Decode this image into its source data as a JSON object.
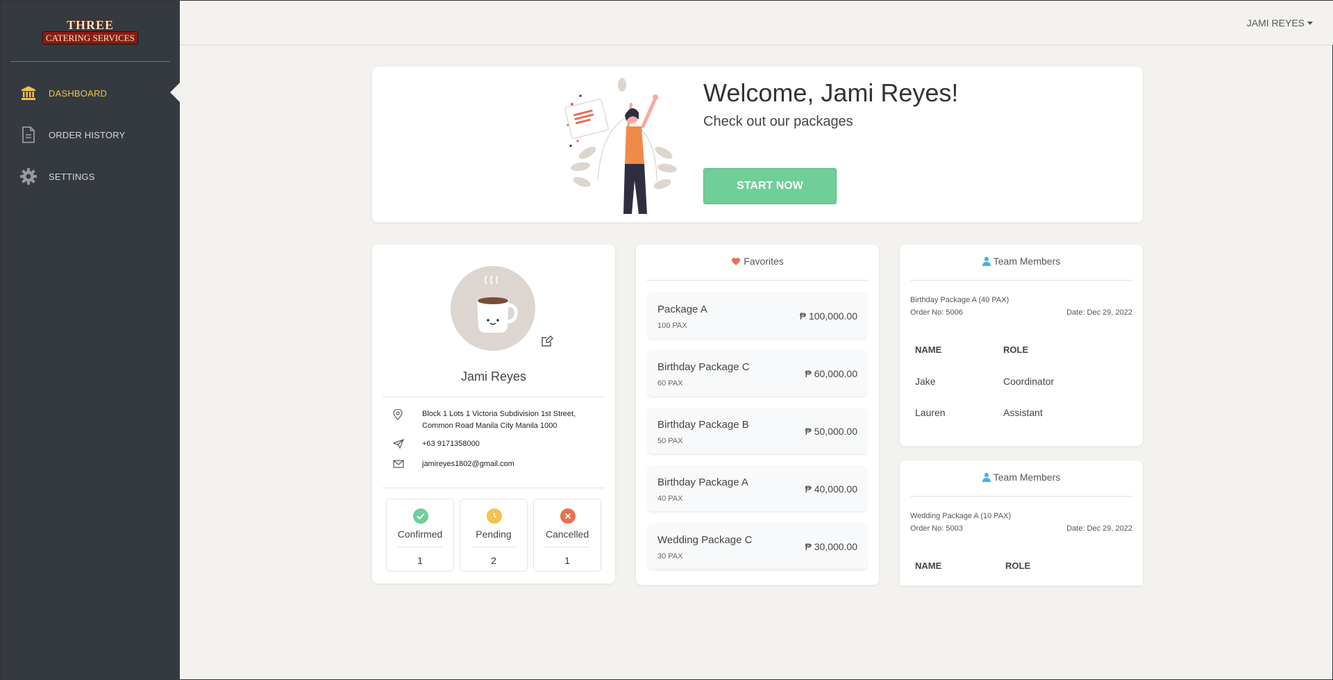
{
  "logo": {
    "line1": "THREE",
    "line2": "CATERING SERVICES"
  },
  "sidebar": {
    "items": [
      {
        "label": "DASHBOARD",
        "icon": "bank-icon"
      },
      {
        "label": "ORDER HISTORY",
        "icon": "document-icon"
      },
      {
        "label": "SETTINGS",
        "icon": "gear-icon"
      }
    ]
  },
  "topbar": {
    "user": "JAMI REYES"
  },
  "welcome": {
    "title": "Welcome, Jami Reyes!",
    "subtitle": "Check out our packages",
    "button": "START NOW"
  },
  "profile": {
    "name": "Jami Reyes",
    "address_line1": "Block 1 Lots 1 Victoria Subdivision 1st Street,",
    "address_line2": "Common Road Manila City Manila 1000",
    "phone": "+63 9171358000",
    "email": "jamireyes1802@gmail.com",
    "stats": [
      {
        "label": "Confirmed",
        "value": "1",
        "color": "#6fcf97"
      },
      {
        "label": "Pending",
        "value": "2",
        "color": "#f5c151"
      },
      {
        "label": "Cancelled",
        "value": "1",
        "color": "#e8704f"
      }
    ]
  },
  "favorites": {
    "title": "Favorites",
    "items": [
      {
        "name": "Package A",
        "pax": "100 PAX",
        "price": "₱ 100,000.00"
      },
      {
        "name": "Birthday Package C",
        "pax": "60 PAX",
        "price": "₱ 60,000.00"
      },
      {
        "name": "Birthday Package B",
        "pax": "50 PAX",
        "price": "₱ 50,000.00"
      },
      {
        "name": "Birthday Package A",
        "pax": "40 PAX",
        "price": "₱ 40,000.00"
      },
      {
        "name": "Wedding Package C",
        "pax": "30 PAX",
        "price": "₱ 30,000.00"
      }
    ]
  },
  "teams": [
    {
      "title": "Team Members",
      "package": "Birthday Package A (40 PAX)",
      "order": "Order No: 5006",
      "date": "Date: Dec 29, 2022",
      "col_name": "NAME",
      "col_role": "ROLE",
      "members": [
        {
          "name": "Jake",
          "role": "Coordinator"
        },
        {
          "name": "Lauren",
          "role": "Assistant"
        }
      ]
    },
    {
      "title": "Team Members",
      "package": "Wedding Package A (10 PAX)",
      "order": "Order No: 5003",
      "date": "Date: Dec 29, 2022",
      "col_name": "NAME",
      "col_role": "ROLE",
      "members": []
    }
  ]
}
